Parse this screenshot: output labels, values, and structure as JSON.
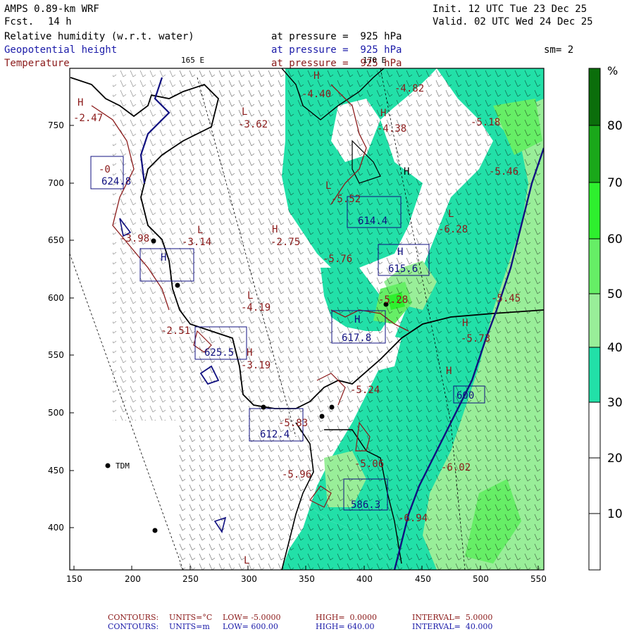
{
  "header": {
    "model": "AMPS 0.89-km WRF",
    "fcst_label": "Fcst.",
    "fcst_value": "14 h",
    "init": "Init. 12 UTC Tue 23 Dec 25",
    "valid": "Valid. 02 UTC Wed 24 Dec 25",
    "rh_label": "Relative humidity (w.r.t. water)",
    "rh_level": "at pressure =  925 hPa",
    "gh_label": "Geopotential height",
    "gh_level": "at pressure =  925 hPa",
    "t_label": "Temperature",
    "t_level": "at pressure =  925 hPa",
    "sm": "sm= 2",
    "lon1": "165 E",
    "lon2": "170 E"
  },
  "colorbar": {
    "unit": "%",
    "ticks": [
      "80",
      "70",
      "60",
      "50",
      "40",
      "30",
      "20",
      "10"
    ],
    "colors": [
      "#0b6e0b",
      "#1aa81a",
      "#2ef02e",
      "#66ee66",
      "#99ee99",
      "#22e0a8",
      "#ffffff",
      "#ffffff",
      "#ffffff",
      "#ffffff"
    ]
  },
  "axes": {
    "x_ticks": [
      "150",
      "200",
      "250",
      "300",
      "350",
      "400",
      "450",
      "500",
      "550"
    ],
    "y_ticks": [
      "750",
      "700",
      "650",
      "600",
      "550",
      "500",
      "450",
      "400"
    ]
  },
  "map_labels": {
    "station": "TDM",
    "temps": [
      "-2.47",
      "-0",
      "-4.40",
      "-4.82",
      "-3.62",
      "-4.38",
      "-5.18",
      "-5.46",
      "-3.98",
      "-3.14",
      "-2.75",
      "-5.52",
      "-6.28",
      "-5.76",
      "-2.51",
      "-4.19",
      "-3.19",
      "-5.28",
      "-5.45",
      "-5.73",
      "-5.83",
      "-5.06",
      "-5.96",
      "-6.02",
      "-5.24",
      "-6.94"
    ],
    "heights": [
      "624.8",
      "614.4",
      "615.6",
      "617.8",
      "625.5",
      "612.4",
      "600",
      "586.3"
    ],
    "highs_lows": [
      "H",
      "L"
    ]
  },
  "footer": {
    "line1_label": "CONTOURS:",
    "line1_units": "UNITS=°C",
    "line1_low": "LOW= -5.0000",
    "line1_high": "HIGH=  0.0000",
    "line1_interval": "INTERVAL=  5.0000",
    "line2_label": "CONTOURS:",
    "line2_units": "UNITS=m",
    "line2_low": "LOW= 600.00",
    "line2_high": "HIGH= 640.00",
    "line2_interval": "INTERVAL=  40.000"
  }
}
